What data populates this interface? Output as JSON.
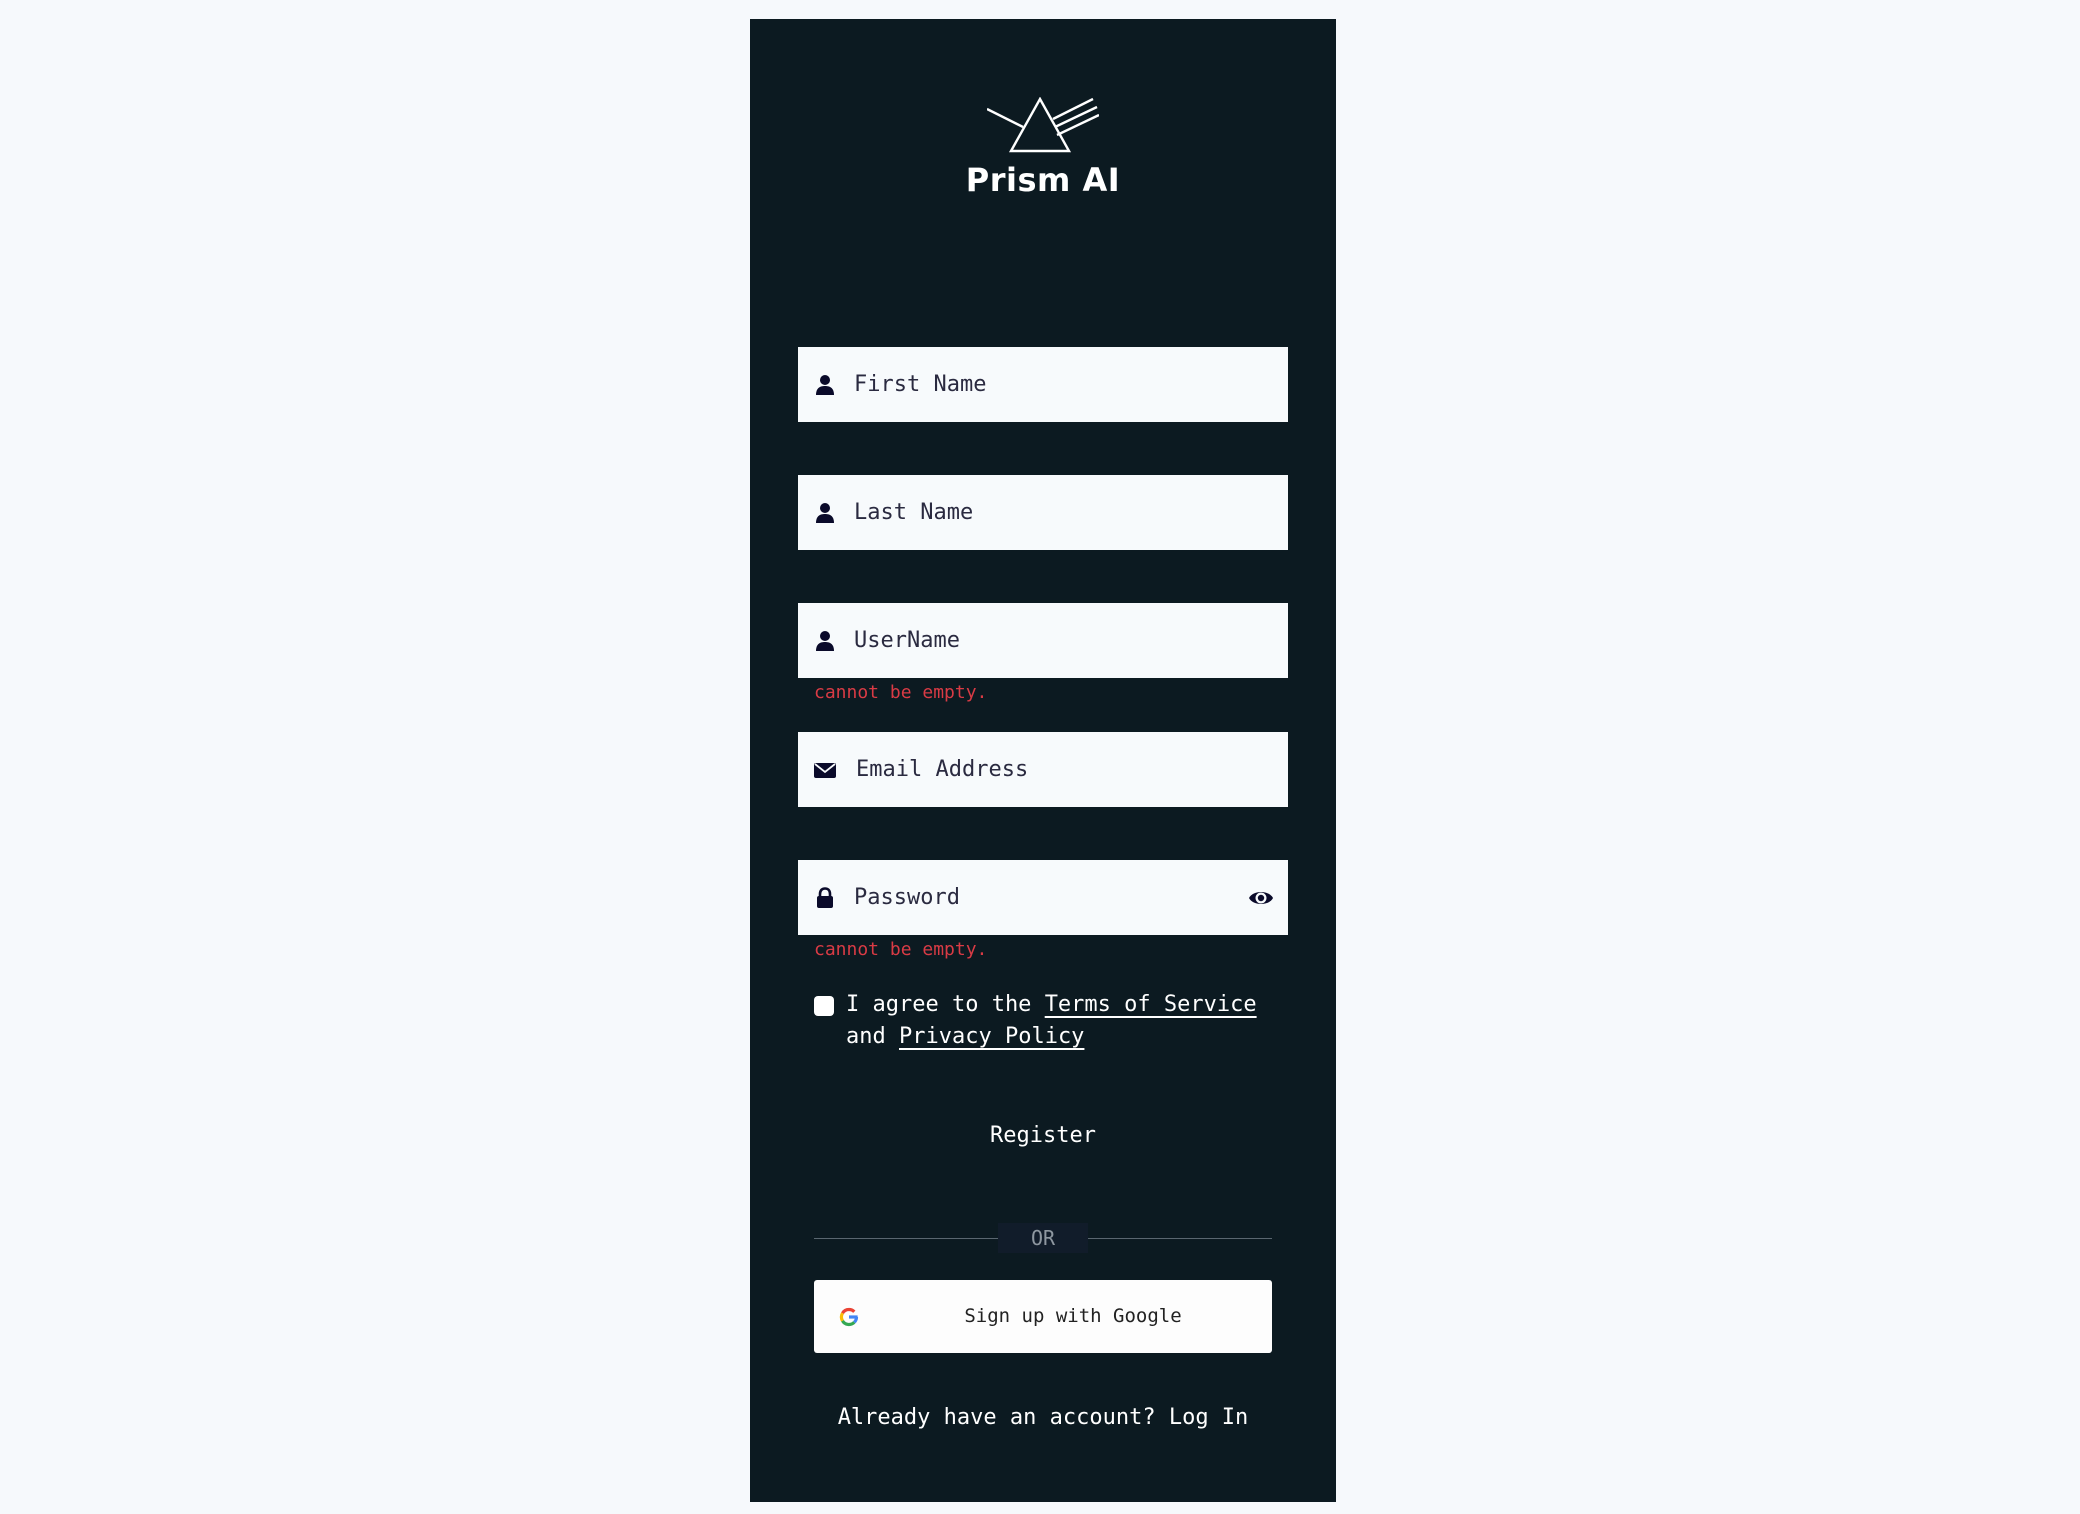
{
  "brand": {
    "name": "Prism AI"
  },
  "form": {
    "first_name": {
      "placeholder": "First Name",
      "value": ""
    },
    "last_name": {
      "placeholder": "Last Name",
      "value": ""
    },
    "username": {
      "placeholder": "UserName",
      "value": "",
      "error": "cannot be empty."
    },
    "email": {
      "placeholder": "Email Address",
      "value": ""
    },
    "password": {
      "placeholder": "Password",
      "value": "",
      "error": "cannot be empty."
    },
    "agree": {
      "prefix": "I agree to the",
      "terms_label": "Terms of Service",
      "joiner": "and",
      "privacy_label": "Privacy Policy",
      "checked": false
    },
    "register_label": "Register"
  },
  "divider": {
    "label": "OR"
  },
  "google": {
    "label": "Sign up with Google"
  },
  "login": {
    "prompt": "Already have an account?",
    "link_label": "Log In"
  },
  "colors": {
    "page_bg": "#f6f9fc",
    "panel_bg": "#0c1a21",
    "error": "#d93b45",
    "icon": "#0a0a2a"
  }
}
